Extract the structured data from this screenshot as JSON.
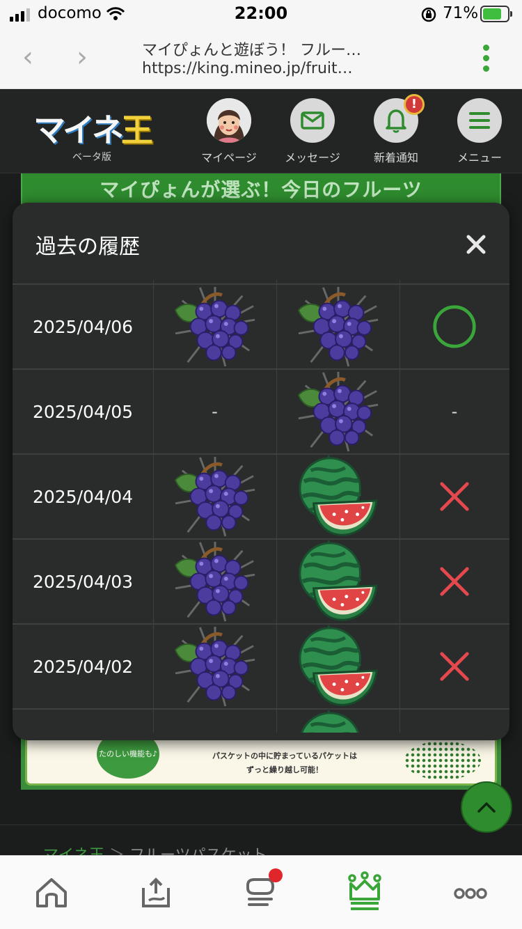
{
  "status_bar": {
    "carrier": "docomo",
    "time": "22:00",
    "battery": "71%"
  },
  "browser": {
    "back": "‹",
    "forward": "›",
    "title": "マイぴょんと遊ぼう！ フルー…",
    "url": "https://king.mineo.jp/fruit…"
  },
  "header": {
    "logo": {
      "main_a": "マイネ",
      "main_b": "王",
      "sub": "ベータ版"
    },
    "nav": [
      {
        "label": "マイページ",
        "icon": "avatar-icon"
      },
      {
        "label": "メッセージ",
        "icon": "envelope-icon"
      },
      {
        "label": "新着通知",
        "icon": "bell-icon",
        "badge": "!"
      },
      {
        "label": "メニュー",
        "icon": "hamburger-icon"
      }
    ]
  },
  "page": {
    "banner_title": "マイぴょんが選ぶ！今日のフルーツ",
    "promo_line1": "パスケットの中に貯まっているパケットは",
    "promo_line2": "ずっと繰り越し可能！",
    "promo_circle": "たのしい機能も♪",
    "breadcrumb": {
      "home": "マイネ王",
      "sep": " ＞ ",
      "current": "フルーツパスケット"
    }
  },
  "modal": {
    "title": "過去の履歴",
    "close_icon": "close-icon",
    "rows": [
      {
        "date": "2025/04/06",
        "pick": "grape",
        "answer": "grape",
        "result": "circle"
      },
      {
        "date": "2025/04/05",
        "pick": "-",
        "answer": "grape",
        "result": "-"
      },
      {
        "date": "2025/04/04",
        "pick": "grape",
        "answer": "watermelon",
        "result": "cross"
      },
      {
        "date": "2025/04/03",
        "pick": "grape",
        "answer": "watermelon",
        "result": "cross"
      },
      {
        "date": "2025/04/02",
        "pick": "grape",
        "answer": "watermelon",
        "result": "cross"
      }
    ]
  },
  "colors": {
    "accent": "#3aa63a",
    "cross": "#e5484d",
    "bg": "#1b1d1d"
  },
  "tabbar": [
    {
      "name": "home-tab",
      "icon": "home-icon"
    },
    {
      "name": "share-tab",
      "icon": "tray-upload-icon"
    },
    {
      "name": "chat-tab",
      "icon": "chat-icon",
      "badge": true
    },
    {
      "name": "king-tab",
      "icon": "crown-icon",
      "active": true
    },
    {
      "name": "more-tab",
      "icon": "more-icon"
    }
  ]
}
